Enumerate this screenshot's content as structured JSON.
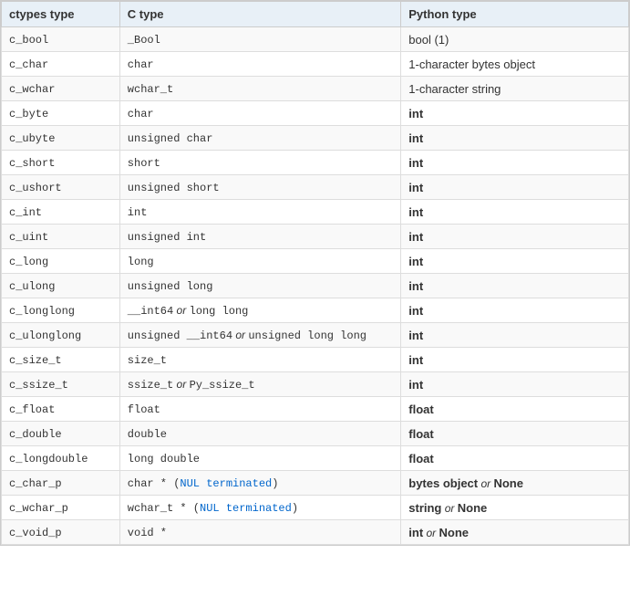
{
  "table": {
    "headers": [
      "ctypes type",
      "C type",
      "Python type"
    ],
    "rows": [
      {
        "ctypes": "c_bool",
        "ctype": "plain",
        "ctype_text": "_Bool",
        "python": "plain",
        "python_text": "bool (1)"
      },
      {
        "ctypes": "c_char",
        "ctype": "plain",
        "ctype_text": "char",
        "python": "plain",
        "python_text": "1-character bytes object"
      },
      {
        "ctypes": "c_wchar",
        "ctype": "plain",
        "ctype_text": "wchar_t",
        "python": "plain",
        "python_text": "1-character string"
      },
      {
        "ctypes": "c_byte",
        "ctype": "plain",
        "ctype_text": "char",
        "python": "bold",
        "python_text": "int"
      },
      {
        "ctypes": "c_ubyte",
        "ctype": "plain",
        "ctype_text": "unsigned char",
        "python": "bold",
        "python_text": "int"
      },
      {
        "ctypes": "c_short",
        "ctype": "plain",
        "ctype_text": "short",
        "python": "bold",
        "python_text": "int"
      },
      {
        "ctypes": "c_ushort",
        "ctype": "plain",
        "ctype_text": "unsigned short",
        "python": "bold",
        "python_text": "int"
      },
      {
        "ctypes": "c_int",
        "ctype": "plain",
        "ctype_text": "int",
        "python": "bold",
        "python_text": "int"
      },
      {
        "ctypes": "c_uint",
        "ctype": "plain",
        "ctype_text": "unsigned int",
        "python": "bold",
        "python_text": "int"
      },
      {
        "ctypes": "c_long",
        "ctype": "plain",
        "ctype_text": "long",
        "python": "bold",
        "python_text": "int"
      },
      {
        "ctypes": "c_ulong",
        "ctype": "plain",
        "ctype_text": "unsigned long",
        "python": "bold",
        "python_text": "int"
      },
      {
        "ctypes": "c_longlong",
        "ctype": "mixed",
        "ctype_text": "__int64",
        "ctype_or": " or ",
        "ctype_text2": "long long",
        "python": "bold",
        "python_text": "int"
      },
      {
        "ctypes": "c_ulonglong",
        "ctype": "mixed2",
        "ctype_text": "unsigned __int64",
        "ctype_or": " or ",
        "ctype_text2": "unsigned long long",
        "python": "bold",
        "python_text": "int"
      },
      {
        "ctypes": "c_size_t",
        "ctype": "plain",
        "ctype_text": "size_t",
        "python": "bold",
        "python_text": "int"
      },
      {
        "ctypes": "c_ssize_t",
        "ctype": "mixed",
        "ctype_text": "ssize_t",
        "ctype_or": " or ",
        "ctype_text2": "Py_ssize_t",
        "python": "bold",
        "python_text": "int"
      },
      {
        "ctypes": "c_float",
        "ctype": "plain",
        "ctype_text": "float",
        "python": "bold",
        "python_text": "float"
      },
      {
        "ctypes": "c_double",
        "ctype": "plain",
        "ctype_text": "double",
        "python": "bold",
        "python_text": "float"
      },
      {
        "ctypes": "c_longdouble",
        "ctype": "plain",
        "ctype_text": "long double",
        "python": "bold",
        "python_text": "float"
      },
      {
        "ctypes": "c_char_p",
        "ctype": "charptr",
        "ctype_text": "char * (NUL terminated)",
        "python": "mixed_or_none",
        "python_text": "bytes object",
        "python_or": " or ",
        "python_text2": "None"
      },
      {
        "ctypes": "c_wchar_p",
        "ctype": "wcharptr",
        "ctype_text": "wchar_t * (NUL terminated)",
        "python": "str_or_none",
        "python_text": "string",
        "python_or": " or ",
        "python_text2": "None"
      },
      {
        "ctypes": "c_void_p",
        "ctype": "plain",
        "ctype_text": "void *",
        "python": "int_or_none",
        "python_text": "int",
        "python_or": " or ",
        "python_text2": "None"
      }
    ]
  }
}
